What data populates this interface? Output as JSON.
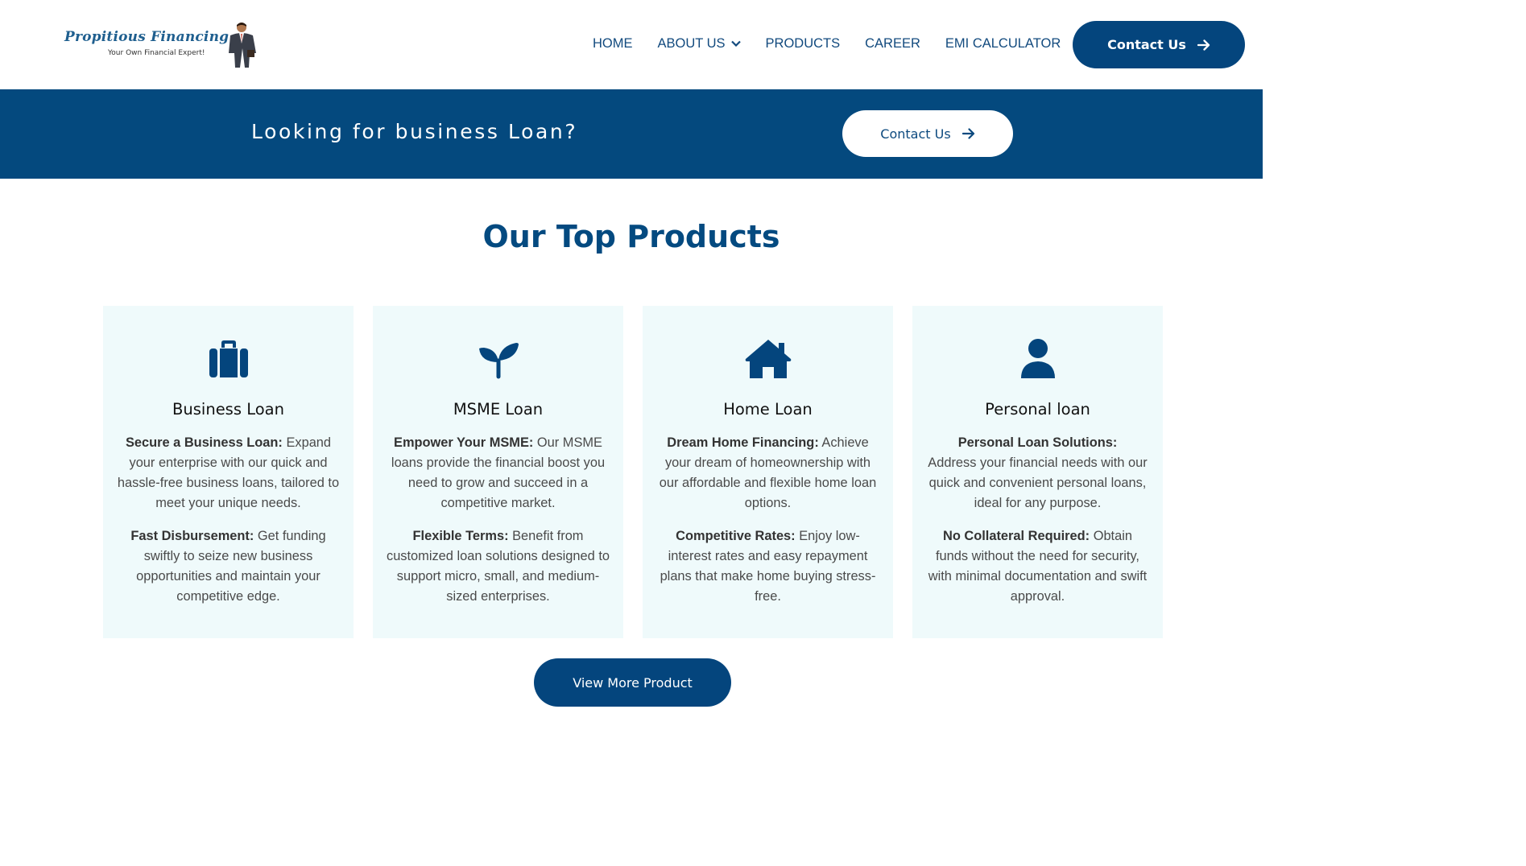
{
  "brand": {
    "name": "Propitious Financing",
    "tagline": "Your Own Financial Expert!"
  },
  "nav": {
    "items": [
      {
        "label": "HOME"
      },
      {
        "label": "ABOUT US"
      },
      {
        "label": "PRODUCTS"
      },
      {
        "label": "CAREER"
      },
      {
        "label": "EMI CALCULATOR"
      }
    ],
    "contact_label": "Contact Us"
  },
  "banner": {
    "text": "Looking for business Loan?",
    "button_label": "Contact Us"
  },
  "products": {
    "title": "Our Top Products",
    "cards": [
      {
        "icon": "briefcase-icon",
        "title": "Business Loan",
        "p1_bold": "Secure a Business Loan:",
        "p1_text": " Expand your enterprise with our quick and hassle-free business loans, tailored to meet your unique needs.",
        "p2_bold": "Fast Disbursement:",
        "p2_text": " Get funding swiftly to seize new business opportunities and maintain your competitive edge."
      },
      {
        "icon": "seedling-icon",
        "title": "MSME Loan",
        "p1_bold": "Empower Your MSME:",
        "p1_text": " Our MSME loans provide the financial boost you need to grow and succeed in a competitive market.",
        "p2_bold": "Flexible Terms:",
        "p2_text": " Benefit from customized loan solutions designed to support micro, small, and medium-sized enterprises."
      },
      {
        "icon": "home-icon",
        "title": "Home Loan",
        "p1_bold": "Dream Home Financing:",
        "p1_text": " Achieve your dream of homeownership with our affordable and flexible home loan options.",
        "p2_bold": "Competitive Rates:",
        "p2_text": " Enjoy low-interest rates and easy repayment plans that make home buying stress-free."
      },
      {
        "icon": "user-icon",
        "title": "Personal loan",
        "p1_bold": "Personal Loan Solutions:",
        "p1_text": " Address your financial needs with our quick and convenient personal loans, ideal for any purpose.",
        "p2_bold": "No Collateral Required:",
        "p2_text": " Obtain funds without the need for security, with minimal documentation and swift approval."
      }
    ],
    "more_label": "View More Product"
  },
  "colors": {
    "primary": "#04457d",
    "banner": "#04497e",
    "card_bg": "#effafb",
    "nav_text": "#124a7e"
  }
}
